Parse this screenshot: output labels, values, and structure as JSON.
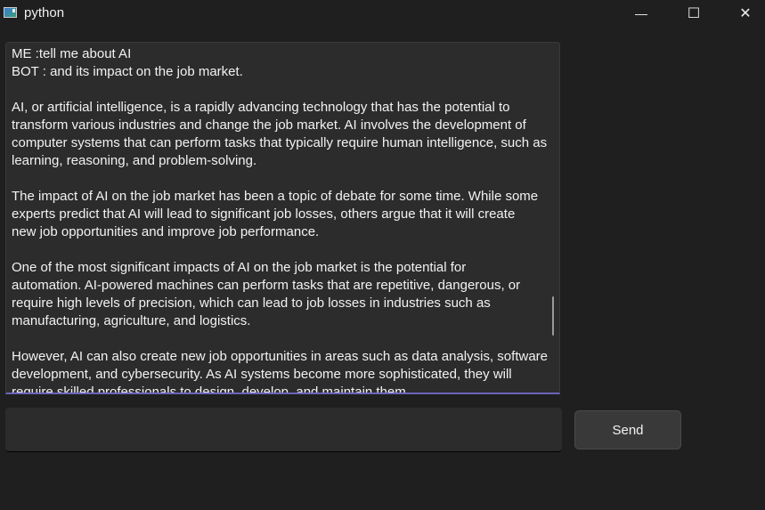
{
  "window": {
    "title": "python",
    "minimize": "—",
    "maximize": "☐",
    "close": "✕"
  },
  "chat": {
    "lines": [
      "ME :tell me about AI",
      "BOT : and its impact on the job market.",
      "",
      "AI, or artificial intelligence, is a rapidly advancing technology that has the potential to",
      "transform various industries and change the job market. AI involves the development of",
      "computer systems that can perform tasks that typically require human intelligence, such as",
      "learning, reasoning, and problem-solving.",
      "",
      "The impact of AI on the job market has been a topic of debate for some time. While some",
      "experts predict that AI will lead to significant job losses, others argue that it will create",
      "new job opportunities and improve job performance.",
      "",
      "One of the most significant impacts of AI on the job market is the potential for",
      "automation. AI-powered machines can perform tasks that are repetitive, dangerous, or",
      "require high levels of precision, which can lead to job losses in industries such as",
      "manufacturing, agriculture, and logistics.",
      "",
      "However, AI can also create new job opportunities in areas such as data analysis, software",
      "development, and cybersecurity. As AI systems become more sophisticated, they will",
      "require skilled professionals to design, develop, and maintain them."
    ]
  },
  "input": {
    "value": ""
  },
  "send_label": "Send"
}
